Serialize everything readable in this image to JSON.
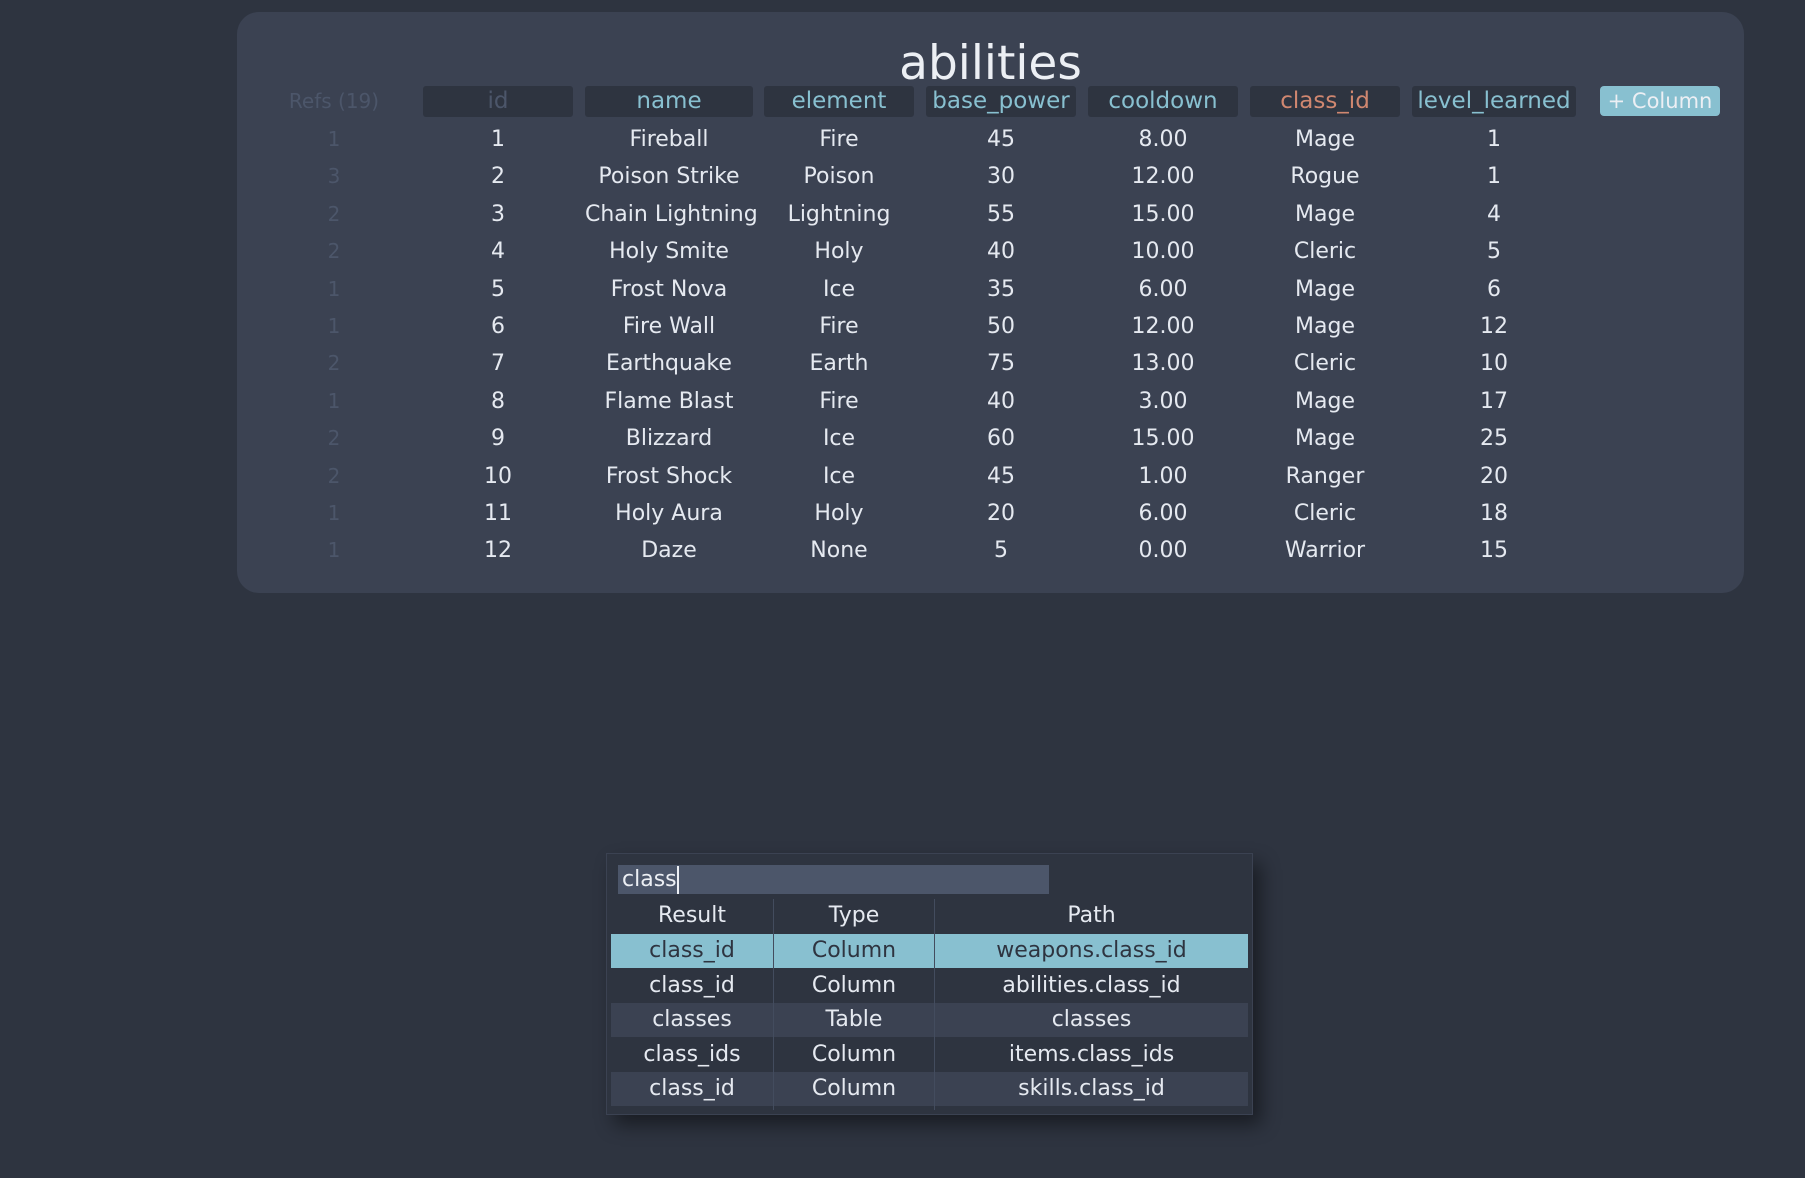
{
  "table": {
    "title": "abilities",
    "refs_label": "Refs (19)",
    "add_column_label": "+ Column",
    "columns": [
      "id",
      "name",
      "element",
      "base_power",
      "cooldown",
      "class_id",
      "level_learned"
    ],
    "rows": [
      {
        "refs": "1",
        "id": "1",
        "name": "Fireball",
        "element": "Fire",
        "base_power": "45",
        "cooldown": "8.00",
        "class_id": "Mage",
        "level_learned": "1"
      },
      {
        "refs": "3",
        "id": "2",
        "name": "Poison Strike",
        "element": "Poison",
        "base_power": "30",
        "cooldown": "12.00",
        "class_id": "Rogue",
        "level_learned": "1"
      },
      {
        "refs": "2",
        "id": "3",
        "name": "Chain Lightning",
        "element": "Lightning",
        "base_power": "55",
        "cooldown": "15.00",
        "class_id": "Mage",
        "level_learned": "4"
      },
      {
        "refs": "2",
        "id": "4",
        "name": "Holy Smite",
        "element": "Holy",
        "base_power": "40",
        "cooldown": "10.00",
        "class_id": "Cleric",
        "level_learned": "5"
      },
      {
        "refs": "1",
        "id": "5",
        "name": "Frost Nova",
        "element": "Ice",
        "base_power": "35",
        "cooldown": "6.00",
        "class_id": "Mage",
        "level_learned": "6"
      },
      {
        "refs": "1",
        "id": "6",
        "name": "Fire Wall",
        "element": "Fire",
        "base_power": "50",
        "cooldown": "12.00",
        "class_id": "Mage",
        "level_learned": "12"
      },
      {
        "refs": "2",
        "id": "7",
        "name": "Earthquake",
        "element": "Earth",
        "base_power": "75",
        "cooldown": "13.00",
        "class_id": "Cleric",
        "level_learned": "10"
      },
      {
        "refs": "1",
        "id": "8",
        "name": "Flame Blast",
        "element": "Fire",
        "base_power": "40",
        "cooldown": "3.00",
        "class_id": "Mage",
        "level_learned": "17"
      },
      {
        "refs": "2",
        "id": "9",
        "name": "Blizzard",
        "element": "Ice",
        "base_power": "60",
        "cooldown": "15.00",
        "class_id": "Mage",
        "level_learned": "25"
      },
      {
        "refs": "2",
        "id": "10",
        "name": "Frost Shock",
        "element": "Ice",
        "base_power": "45",
        "cooldown": "1.00",
        "class_id": "Ranger",
        "level_learned": "20"
      },
      {
        "refs": "1",
        "id": "11",
        "name": "Holy Aura",
        "element": "Holy",
        "base_power": "20",
        "cooldown": "6.00",
        "class_id": "Cleric",
        "level_learned": "18"
      },
      {
        "refs": "1",
        "id": "12",
        "name": "Daze",
        "element": "None",
        "base_power": "5",
        "cooldown": "0.00",
        "class_id": "Warrior",
        "level_learned": "15"
      }
    ]
  },
  "search": {
    "query": "class",
    "headers": [
      "Result",
      "Type",
      "Path"
    ],
    "results": [
      {
        "result": "class_id",
        "type": "Column",
        "path": "weapons.class_id"
      },
      {
        "result": "class_id",
        "type": "Column",
        "path": "abilities.class_id"
      },
      {
        "result": "classes",
        "type": "Table",
        "path": "classes"
      },
      {
        "result": "class_ids",
        "type": "Column",
        "path": "items.class_ids"
      },
      {
        "result": "class_id",
        "type": "Column",
        "path": "skills.class_id"
      }
    ]
  },
  "colors": {
    "background": "#2e3440",
    "panel": "#3b4252",
    "accent": "#88c0d0",
    "foreign_key": "#d08770",
    "muted": "#4c566a",
    "text": "#e5e9f0"
  }
}
